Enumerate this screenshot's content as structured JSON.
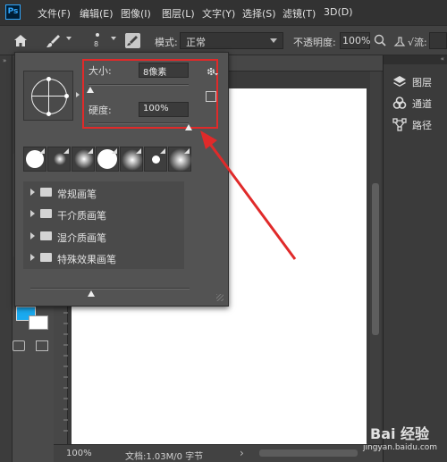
{
  "menubar": {
    "logo": "Ps",
    "items": [
      {
        "label": "文件(F)"
      },
      {
        "label": "编辑(E)"
      },
      {
        "label": "图像(I)"
      },
      {
        "label": "图层(L)"
      },
      {
        "label": "文字(Y)"
      },
      {
        "label": "选择(S)"
      },
      {
        "label": "滤镜(T)"
      },
      {
        "label": "3D(D)"
      }
    ]
  },
  "options_bar": {
    "brush_size": "8",
    "mode_label": "模式:",
    "mode_value": "正常",
    "opacity_label": "不透明度:",
    "opacity_value": "100%",
    "trailing_text": "√流:"
  },
  "brush_picker": {
    "size_label": "大小:",
    "size_value": "8像素",
    "hardness_label": "硬度:",
    "hardness_value": "100%",
    "size_slider_level": 0.02,
    "hardness_slider_level": 1.0,
    "spacing_slider_level": 0.38,
    "groups": [
      {
        "label": "常规画笔"
      },
      {
        "label": "干介质画笔"
      },
      {
        "label": "湿介质画笔"
      },
      {
        "label": "特殊效果画笔"
      }
    ]
  },
  "right_panel": {
    "items": [
      {
        "label": "图层",
        "icon": "layers-icon"
      },
      {
        "label": "通道",
        "icon": "channels-icon"
      },
      {
        "label": "路径",
        "icon": "paths-icon"
      }
    ]
  },
  "status_bar": {
    "zoom": "100%",
    "doc_info": "文档:1.03M/0 字节"
  },
  "colors": {
    "foreground": "#1aaaf0",
    "background": "#ffffff",
    "annotation": "#e02a2a"
  },
  "watermark": {
    "text": "Bai 经验",
    "url": "jingyan.baidu.com"
  }
}
